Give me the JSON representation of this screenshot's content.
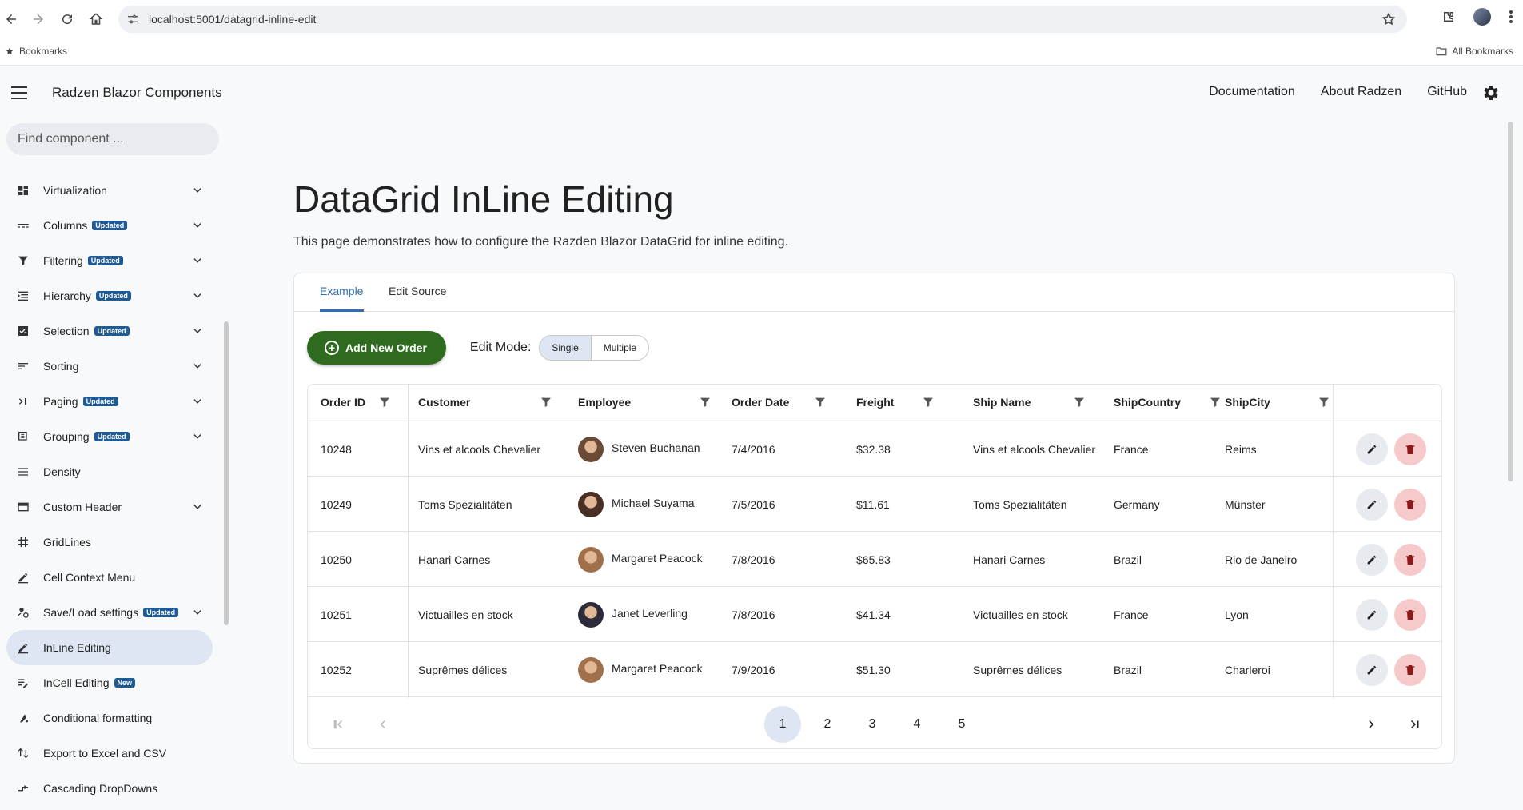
{
  "browser": {
    "url": "localhost:5001/datagrid-inline-edit",
    "bookmarks_label": "Bookmarks",
    "all_bookmarks_label": "All Bookmarks"
  },
  "header": {
    "app_title": "Radzen Blazor Components",
    "links": [
      "Documentation",
      "About Radzen",
      "GitHub"
    ]
  },
  "sidebar": {
    "search_placeholder": "Find component ...",
    "items": [
      {
        "label": "Virtualization",
        "icon": "dashboard-icon",
        "badge": "",
        "expand": true
      },
      {
        "label": "Columns",
        "icon": "columns-icon",
        "badge": "Updated",
        "expand": true
      },
      {
        "label": "Filtering",
        "icon": "filter-icon",
        "badge": "Updated",
        "expand": true
      },
      {
        "label": "Hierarchy",
        "icon": "hierarchy-icon",
        "badge": "Updated",
        "expand": true
      },
      {
        "label": "Selection",
        "icon": "checkbox-icon",
        "badge": "Updated",
        "expand": true
      },
      {
        "label": "Sorting",
        "icon": "sort-icon",
        "badge": "",
        "expand": true
      },
      {
        "label": "Paging",
        "icon": "paging-icon",
        "badge": "Updated",
        "expand": true
      },
      {
        "label": "Grouping",
        "icon": "grouping-icon",
        "badge": "Updated",
        "expand": true
      },
      {
        "label": "Density",
        "icon": "density-icon",
        "badge": "",
        "expand": false
      },
      {
        "label": "Custom Header",
        "icon": "header-icon",
        "badge": "",
        "expand": true
      },
      {
        "label": "GridLines",
        "icon": "grid-icon",
        "badge": "",
        "expand": false
      },
      {
        "label": "Cell Context Menu",
        "icon": "edit-icon",
        "badge": "",
        "expand": false
      },
      {
        "label": "Save/Load settings",
        "icon": "settings-user-icon",
        "badge": "Updated",
        "expand": true
      },
      {
        "label": "InLine Editing",
        "icon": "edit-icon",
        "badge": "",
        "expand": false,
        "active": true
      },
      {
        "label": "InCell Editing",
        "icon": "edit-note-icon",
        "badge": "New",
        "expand": false
      },
      {
        "label": "Conditional formatting",
        "icon": "format-icon",
        "badge": "",
        "expand": false
      },
      {
        "label": "Export to Excel and CSV",
        "icon": "export-icon",
        "badge": "",
        "expand": false
      },
      {
        "label": "Cascading DropDowns",
        "icon": "cascade-icon",
        "badge": "",
        "expand": false
      }
    ]
  },
  "main": {
    "title": "DataGrid InLine Editing",
    "description": "This page demonstrates how to configure the Razden Blazor DataGrid for inline editing.",
    "tabs": [
      "Example",
      "Edit Source"
    ],
    "add_button": "Add New Order",
    "edit_mode_label": "Edit Mode:",
    "edit_modes": [
      "Single",
      "Multiple"
    ],
    "selected_edit_mode": "Single"
  },
  "grid": {
    "columns": [
      "Order ID",
      "Customer",
      "Employee",
      "Order Date",
      "Freight",
      "Ship Name",
      "ShipCountry",
      "ShipCity"
    ],
    "rows": [
      {
        "order_id": "10248",
        "customer": "Vins et alcools Chevalier",
        "employee": "Steven Buchanan",
        "order_date": "7/4/2016",
        "freight": "$32.38",
        "ship_name": "Vins et alcools Chevalier",
        "ship_country": "France",
        "ship_city": "Reims"
      },
      {
        "order_id": "10249",
        "customer": "Toms Spezialitäten",
        "employee": "Michael Suyama",
        "order_date": "7/5/2016",
        "freight": "$11.61",
        "ship_name": "Toms Spezialitäten",
        "ship_country": "Germany",
        "ship_city": "Münster"
      },
      {
        "order_id": "10250",
        "customer": "Hanari Carnes",
        "employee": "Margaret Peacock",
        "order_date": "7/8/2016",
        "freight": "$65.83",
        "ship_name": "Hanari Carnes",
        "ship_country": "Brazil",
        "ship_city": "Rio de Janeiro"
      },
      {
        "order_id": "10251",
        "customer": "Victuailles en stock",
        "employee": "Janet Leverling",
        "order_date": "7/8/2016",
        "freight": "$41.34",
        "ship_name": "Victuailles en stock",
        "ship_country": "France",
        "ship_city": "Lyon"
      },
      {
        "order_id": "10252",
        "customer": "Suprêmes délices",
        "employee": "Margaret Peacock",
        "order_date": "7/9/2016",
        "freight": "$51.30",
        "ship_name": "Suprêmes délices",
        "ship_country": "Brazil",
        "ship_city": "Charleroi"
      }
    ],
    "pager": {
      "pages": [
        "1",
        "2",
        "3",
        "4",
        "5"
      ],
      "current": "1"
    }
  },
  "colors": {
    "accent": "#2f6db5",
    "add_button": "#2e6b1e",
    "badge": "#1f5a94",
    "active_nav": "#dde6f2",
    "delete_bg": "#f6caca"
  }
}
